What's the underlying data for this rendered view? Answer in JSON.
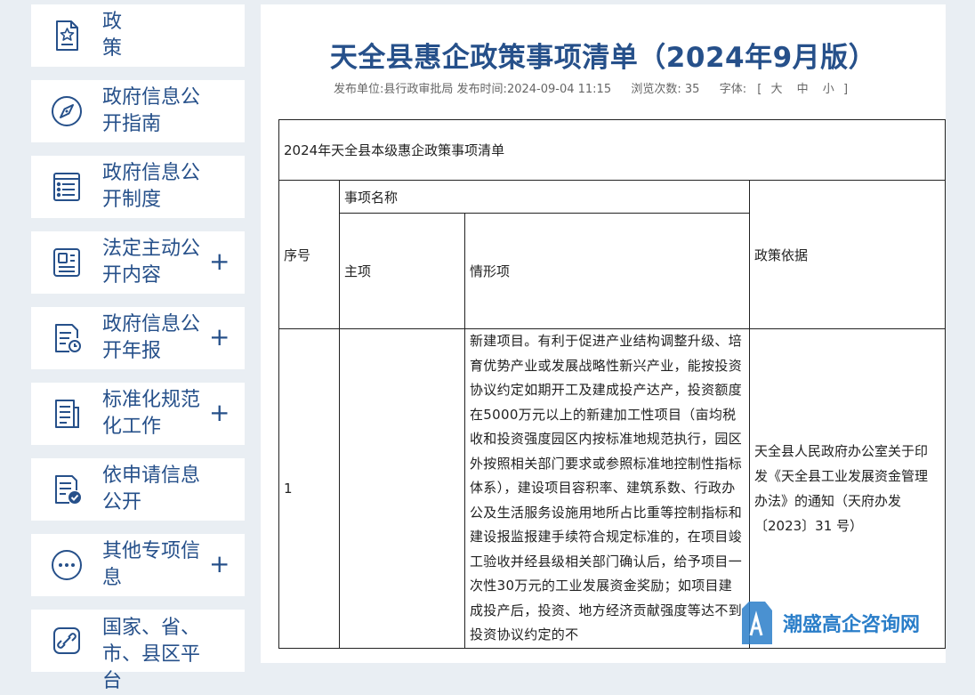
{
  "sidebar": {
    "items": [
      {
        "label": "政 策",
        "icon": "document-star-icon",
        "expandable": false
      },
      {
        "label": "政府信息公开指南",
        "icon": "compass-icon",
        "expandable": false
      },
      {
        "label": "政府信息公开制度",
        "icon": "list-document-icon",
        "expandable": false
      },
      {
        "label": "法定主动公开内容",
        "icon": "profile-card-icon",
        "expandable": true
      },
      {
        "label": "政府信息公开年报",
        "icon": "report-clock-icon",
        "expandable": true
      },
      {
        "label": "标准化规范化工作",
        "icon": "lines-document-icon",
        "expandable": true
      },
      {
        "label": "依申请信息公开",
        "icon": "document-check-icon",
        "expandable": false
      },
      {
        "label": "其他专项信息",
        "icon": "more-dots-icon",
        "expandable": true
      },
      {
        "label": "国家、省、市、县区平台",
        "icon": "link-icon",
        "expandable": false
      }
    ],
    "plus_symbol": "+"
  },
  "article": {
    "title": "天全县惠企政策事项清单（2024年9月版）",
    "publisher_label": "发布单位:",
    "publisher": "县行政审批局",
    "publish_time_label": "发布时间:",
    "publish_time": "2024-09-04 11:15",
    "views_label": "浏览次数:",
    "views": "35",
    "font_label": "字体:",
    "font_open": "[",
    "font_large": "大",
    "font_medium": "中",
    "font_small": "小",
    "font_close": "]"
  },
  "table": {
    "caption": "2024年天全县本级惠企政策事项清单",
    "headers": {
      "seq": "序号",
      "item_name": "事项名称",
      "main_item": "主项",
      "situation_item": "情形项",
      "policy_basis": "政策依据"
    },
    "rows": [
      {
        "seq": "1",
        "main_item": "",
        "situation_item": "新建项目。有利于促进产业结构调整升级、培育优势产业或发展战略性新兴产业，能按投资协议约定如期开工及建成投产达产，投资额度在5000万元以上的新建加工性项目（亩均税收和投资强度园区内按标准地规范执行，园区外按照相关部门要求或参照标准地控制性指标体系），建设项目容积率、建筑系数、行政办公及生活服务设施用地所占比重等控制指标和建设报监报建手续符合规定标准的，在项目竣工验收并经县级相关部门确认后，给予项目一次性30万元的工业发展资金奖励；如项目建成投产后，投资、地方经济贡献强度等达不到投资协议约定的不",
        "policy_basis": "天全县人民政府办公室关于印发《天全县工业发展资金管理办法》的通知（天府办发〔2023〕31 号）"
      }
    ]
  },
  "watermark": {
    "text": "潮盛高企咨询网"
  },
  "colors": {
    "page_background": "#e9eef3",
    "accent_blue": "#26508a",
    "watermark_blue": "#2a7ec9",
    "table_border": "#222222"
  }
}
